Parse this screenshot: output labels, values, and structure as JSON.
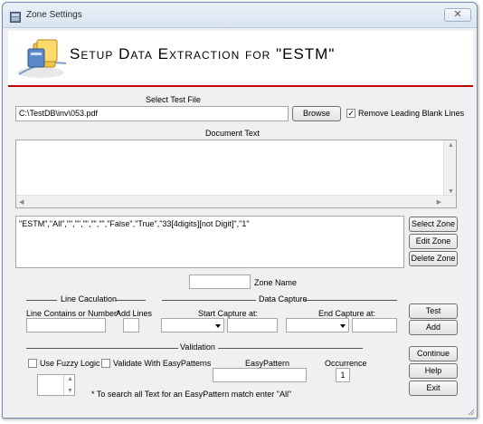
{
  "window": {
    "title": "Zone Settings",
    "close_glyph": "✕"
  },
  "header": {
    "title": "Setup Data Extraction for \"ESTM\""
  },
  "test_file": {
    "label": "Select Test File",
    "path": "C:\\TestDB\\inv\\053.pdf",
    "browse_label": "Browse",
    "remove_blank_label": "Remove Leading Blank Lines",
    "remove_blank_checked": true
  },
  "document_text": {
    "label": "Document Text",
    "content": ""
  },
  "zones": {
    "entry": "\"ESTM\",\"All\",\"\",\"\",\"\",\"\",\"\",\"False\",\"True\",\"33[4digits][not Digit]\",\"1\"",
    "select_label": "Select Zone",
    "edit_label": "Edit Zone",
    "delete_label": "Delete Zone"
  },
  "zone_name": {
    "label": "Zone Name",
    "value": ""
  },
  "line_calc": {
    "section_label": "Line Caculation",
    "contains_label": "Line Contains or Number*",
    "add_lines_label": "Add Lines"
  },
  "data_capture": {
    "section_label": "Data Capture",
    "start_label": "Start Capture at:",
    "end_label": "End Capture at:"
  },
  "actions": {
    "test_label": "Test",
    "add_label": "Add"
  },
  "validation": {
    "section_label": "Validation",
    "fuzzy_label": "Use Fuzzy Logic",
    "fuzzy_checked": false,
    "easypattern_check_label": "Validate With EasyPatterns",
    "easypattern_checked": false,
    "easypattern_label": "EasyPattern",
    "occurrence_label": "Occurrence",
    "occurrence_value": "1",
    "note": "* To search all Text for an EasyPattern match enter \"All\""
  },
  "footer_buttons": {
    "continue_label": "Continue",
    "help_label": "Help",
    "exit_label": "Exit"
  },
  "icons": [
    "app-icon",
    "folder-logo-icon",
    "close-icon",
    "checkmark-icon",
    "dropdown-arrow-icon",
    "scroll-arrow-icon"
  ]
}
